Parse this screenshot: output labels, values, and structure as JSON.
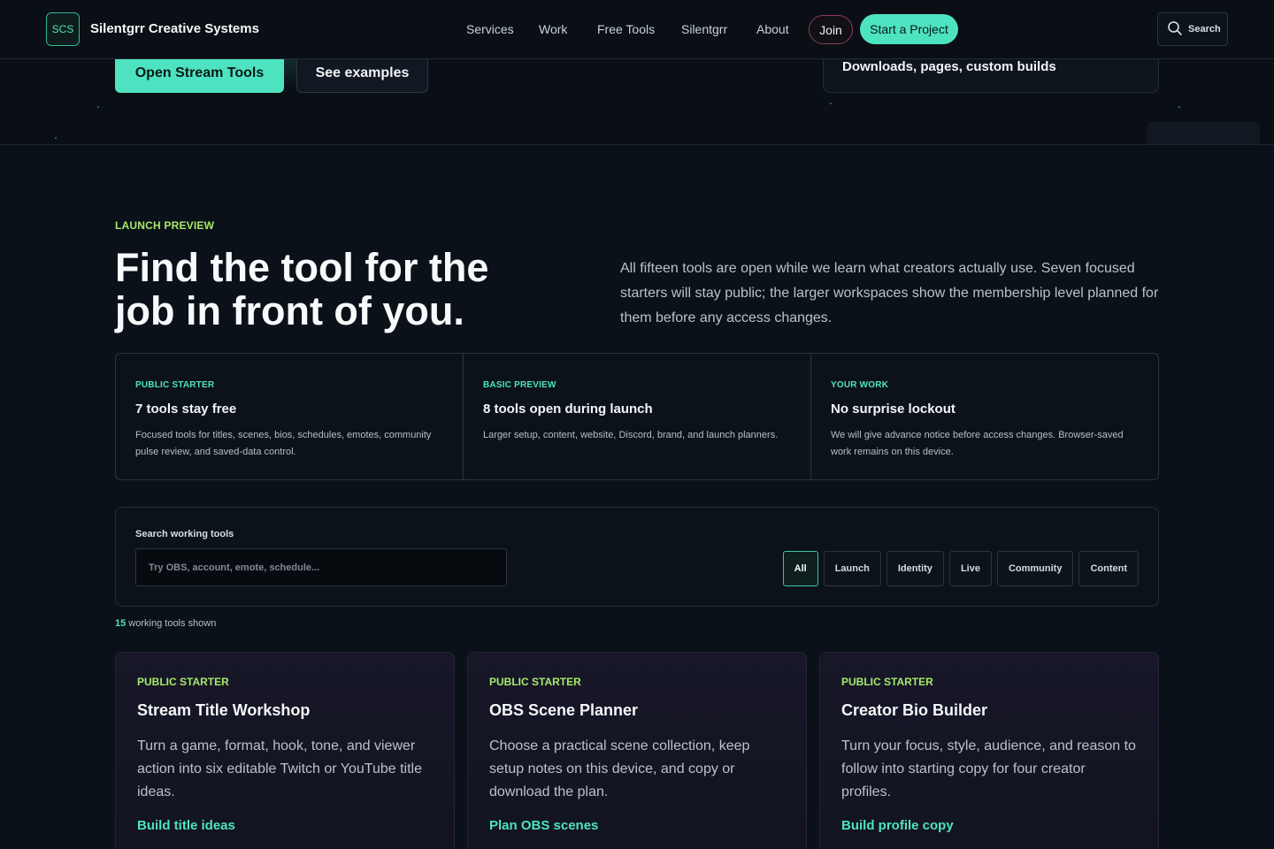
{
  "nav": {
    "logo": "SCS",
    "brand": "Silentgrr Creative Systems",
    "links": [
      "Services",
      "Work",
      "Free Tools",
      "Silentgrr",
      "About"
    ],
    "join": "Join",
    "start": "Start a Project",
    "search": "Search"
  },
  "hero": {
    "primary_button": "Open Stream Tools",
    "secondary_button": "See examples",
    "card_text": "Downloads, pages, custom builds"
  },
  "section": {
    "eyebrow": "LAUNCH PREVIEW",
    "title": "Find the tool for the job in front of you.",
    "intro": "All fifteen tools are open while we learn what creators actually use. Seven focused starters will stay public; the larger workspaces show the membership level planned for them before any access changes."
  },
  "info": [
    {
      "tag": "PUBLIC STARTER",
      "title": "7 tools stay free",
      "desc": "Focused tools for titles, scenes, bios, schedules, emotes, community pulse review, and saved-data control."
    },
    {
      "tag": "BASIC PREVIEW",
      "title": "8 tools open during launch",
      "desc": "Larger setup, content, website, Discord, brand, and launch planners."
    },
    {
      "tag": "YOUR WORK",
      "title": "No surprise lockout",
      "desc": "We will give advance notice before access changes. Browser-saved work remains on this device."
    }
  ],
  "search": {
    "label": "Search working tools",
    "placeholder": "Try OBS, account, emote, schedule...",
    "filters": [
      "All",
      "Launch",
      "Identity",
      "Live",
      "Community",
      "Content"
    ],
    "active_filter": "All"
  },
  "count": {
    "number": "15",
    "text": " working tools shown"
  },
  "tools": [
    {
      "tag": "PUBLIC STARTER",
      "title": "Stream Title Workshop",
      "desc": "Turn a game, format, hook, tone, and viewer action into six editable Twitch or YouTube title ideas.",
      "link": "Build title ideas"
    },
    {
      "tag": "PUBLIC STARTER",
      "title": "OBS Scene Planner",
      "desc": "Choose a practical scene collection, keep setup notes on this device, and copy or download the plan.",
      "link": "Plan OBS scenes"
    },
    {
      "tag": "PUBLIC STARTER",
      "title": "Creator Bio Builder",
      "desc": "Turn your focus, style, audience, and reason to follow into starting copy for four creator profiles.",
      "link": "Build profile copy"
    }
  ],
  "colors": {
    "accent": "#4ee3c0",
    "eyebrow": "#a6e86a",
    "background": "#0b1118"
  }
}
